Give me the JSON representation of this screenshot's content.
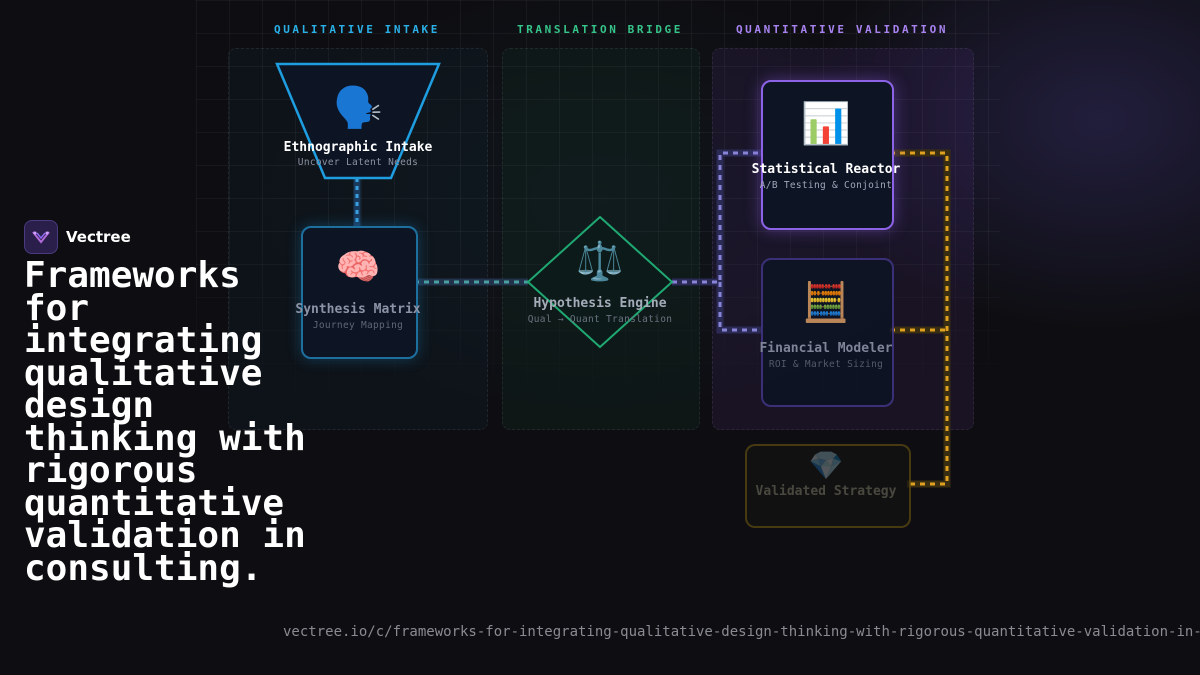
{
  "zones": {
    "qualitative": "QUALITATIVE INTAKE",
    "bridge": "TRANSLATION BRIDGE",
    "quantitative": "QUANTITATIVE VALIDATION"
  },
  "nodes": {
    "ethnographic": {
      "icon": "🗣️",
      "title": "Ethnographic Intake",
      "sub": "Uncover Latent Needs"
    },
    "synthesis": {
      "icon": "🧠",
      "title": "Synthesis Matrix",
      "sub": "Journey Mapping"
    },
    "hypothesis": {
      "icon": "⚖️",
      "title": "Hypothesis Engine",
      "sub": "Qual → Quant Translation"
    },
    "statistical": {
      "icon": "📊",
      "title": "Statistical Reactor",
      "sub": "A/B Testing & Conjoint"
    },
    "financial": {
      "icon": "🧮",
      "title": "Financial Modeler",
      "sub": "ROI & Market Sizing"
    },
    "validated": {
      "icon": "💎",
      "title": "Validated Strategy"
    }
  },
  "colors": {
    "qualitative": "#2ab0e6",
    "bridge": "#35c489",
    "quantitative": "#a883f0",
    "output": "#e0a020"
  },
  "brand": {
    "name": "Vectree",
    "logo_icon": "vectree-logo-icon"
  },
  "headline": "Frameworks for integrating qualitative design thinking with rigorous quantitative validation in consulting.",
  "url": "vectree.io/c/frameworks-for-integrating-qualitative-design-thinking-with-rigorous-quantitative-validation-in-"
}
